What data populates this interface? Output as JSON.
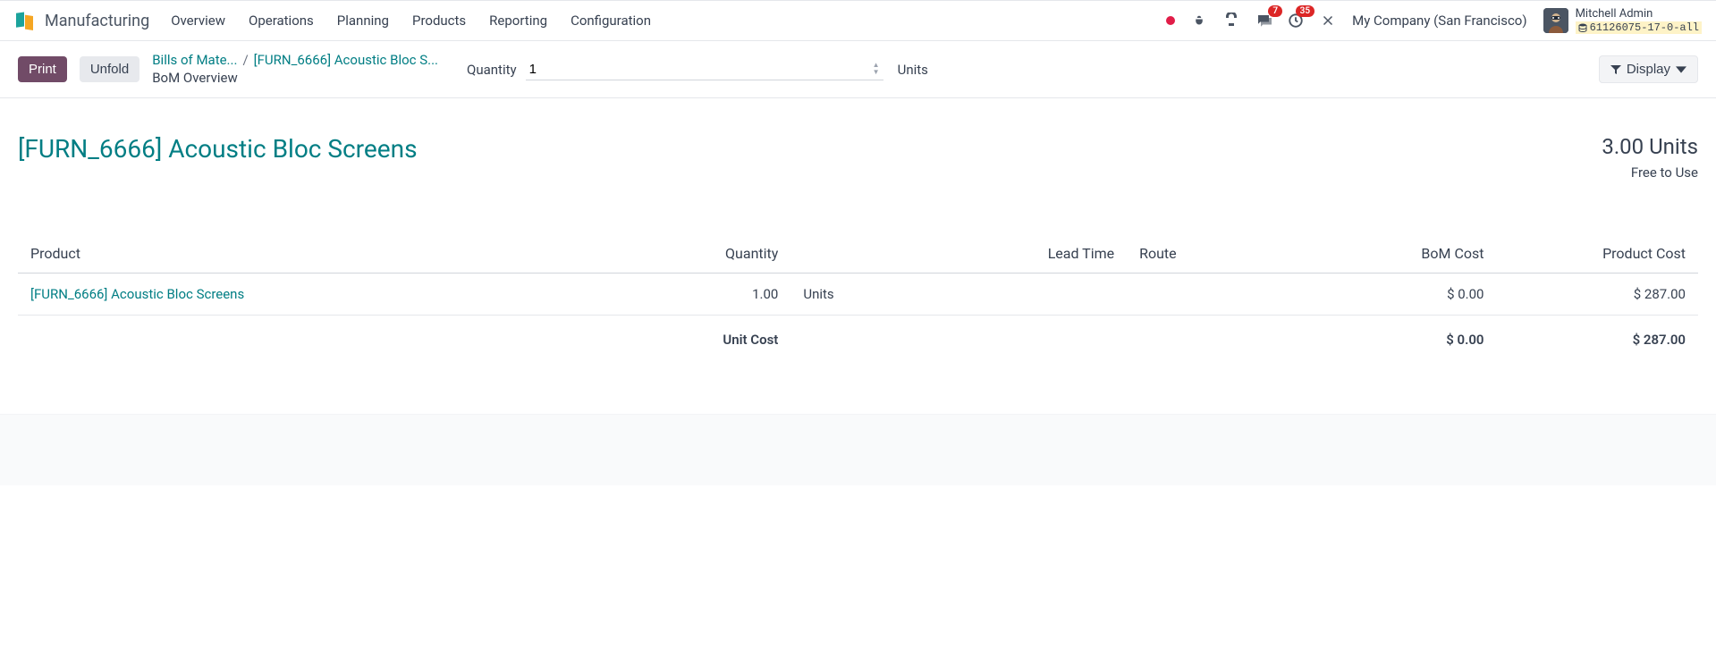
{
  "app_title": "Manufacturing",
  "nav": [
    "Overview",
    "Operations",
    "Planning",
    "Products",
    "Reporting",
    "Configuration"
  ],
  "badges": {
    "messages": "7",
    "activities": "35"
  },
  "company": "My Company (San Francisco)",
  "user": {
    "name": "Mitchell Admin",
    "db": "61126075-17-0-all"
  },
  "buttons": {
    "print": "Print",
    "unfold": "Unfold",
    "display": "Display"
  },
  "breadcrumb": {
    "a": "Bills of Mate...",
    "b": "[FURN_6666] Acoustic Bloc S...",
    "c": "BoM Overview"
  },
  "qty": {
    "label": "Quantity",
    "value": "1",
    "unit": "Units"
  },
  "report": {
    "title": "[FURN_6666] Acoustic Bloc Screens",
    "qty": "3.00 Units",
    "sub": "Free to Use"
  },
  "table": {
    "headers": {
      "product": "Product",
      "quantity": "Quantity",
      "uom": "",
      "lead": "Lead Time",
      "route": "Route",
      "bom_cost": "BoM Cost",
      "prod_cost": "Product Cost"
    },
    "row": {
      "product": "[FURN_6666] Acoustic Bloc Screens",
      "quantity": "1.00",
      "uom": "Units",
      "lead": "",
      "route": "",
      "bom_cost": "$ 0.00",
      "prod_cost": "$ 287.00"
    },
    "footer": {
      "label": "Unit Cost",
      "bom_cost": "$ 0.00",
      "prod_cost": "$ 287.00"
    }
  }
}
